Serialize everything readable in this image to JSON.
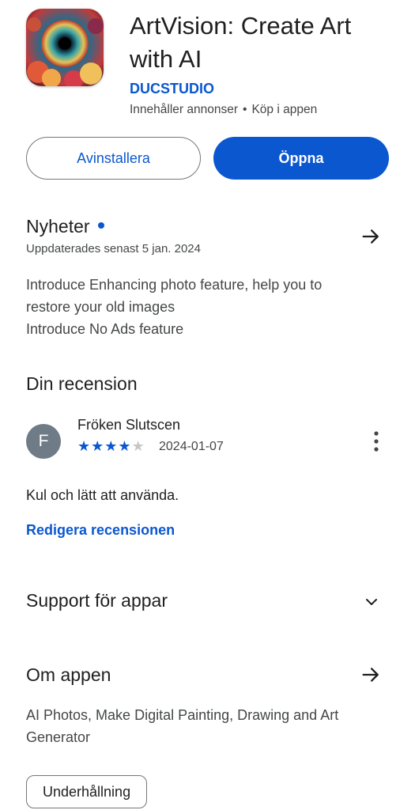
{
  "app": {
    "title": "ArtVision: Create Art with AI",
    "developer": "DUCSTUDIO",
    "meta_ads": "Innehåller annonser",
    "meta_separator": "•",
    "meta_purchases": "Köp i appen",
    "icon": "artvision-app-icon"
  },
  "buttons": {
    "uninstall_label": "Avinstallera",
    "open_label": "Öppna"
  },
  "news": {
    "title": "Nyheter",
    "updated": "Uppdaterades senast 5 jan. 2024",
    "lines": [
      "Introduce Enhancing photo feature, help you to",
      "restore your old images",
      "Introduce No Ads feature"
    ],
    "arrow_icon": "arrow-right-icon"
  },
  "review": {
    "section_title": "Din recension",
    "avatar_letter": "F",
    "reviewer_name": "Fröken Slutscen",
    "rating": 4,
    "rating_max": 5,
    "date": "2024-01-07",
    "text": "Kul och lätt att använda.",
    "edit_link": "Redigera recensionen",
    "more_icon": "more-vert-icon"
  },
  "support": {
    "title": "Support för appar",
    "icon": "chevron-down-icon"
  },
  "about": {
    "title": "Om appen",
    "description_lines": [
      "AI Photos, Make Digital Painting, Drawing and Art",
      "Generator"
    ],
    "category_chip": "Underhållning",
    "arrow_icon": "arrow-right-icon"
  },
  "colors": {
    "accent": "#0b57d0",
    "text_primary": "#1f1f1f",
    "text_secondary": "#444746",
    "avatar_bg": "#6f7b86"
  }
}
